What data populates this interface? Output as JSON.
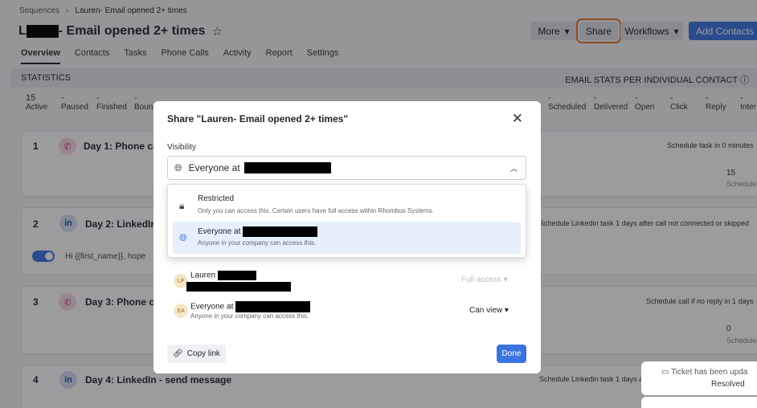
{
  "breadcrumb": {
    "root": "Sequences",
    "separator": "›",
    "current": "Lauren- Email opened 2+ times"
  },
  "title": {
    "prefix": "L",
    "suffix": "- Email opened 2+ times"
  },
  "header_buttons": {
    "more": "More",
    "share": "Share",
    "workflows": "Workflows",
    "add_contacts": "Add Contacts"
  },
  "tabs": [
    "Overview",
    "Contacts",
    "Tasks",
    "Phone Calls",
    "Activity",
    "Report",
    "Settings"
  ],
  "stats": {
    "left_label": "STATISTICS",
    "right_label": "EMAIL STATS PER INDIVIDUAL CONTACT",
    "left_items": [
      {
        "value": "15",
        "label": "Active"
      },
      {
        "value": "-",
        "label": "Paused"
      },
      {
        "value": "-",
        "label": "Finished"
      },
      {
        "value": "-",
        "label": "Bound"
      }
    ],
    "right_items": [
      {
        "value": "-",
        "label": "Scheduled"
      },
      {
        "value": "-",
        "label": "Delivered"
      },
      {
        "value": "-",
        "label": "Open"
      },
      {
        "value": "-",
        "label": "Click"
      },
      {
        "value": "-",
        "label": "Reply"
      },
      {
        "value": "-",
        "label": "Inter"
      }
    ]
  },
  "steps": [
    {
      "num": "1",
      "label": "Day 1: Phone ca",
      "right": "Schedule task in 0 minutes",
      "count": "15",
      "count_label": "Schedule"
    },
    {
      "num": "2",
      "label": "Day 2: LinkedIn",
      "right": "Schedule Linkedin task 1 days after call not connected or skipped",
      "message": "Hi {{first_name}}, hope"
    },
    {
      "num": "3",
      "label": "Day 3: Phone ca",
      "right": "Schedule call if no reply in 1 days",
      "count": "0",
      "count_label": "Schedule"
    },
    {
      "num": "4",
      "label": "Day 4: LinkedIn - send message",
      "right": "Schedule Linkedin task 1 days a"
    }
  ],
  "modal": {
    "title": "Share \"Lauren- Email opened 2+ times\"",
    "visibility_label": "Visibility",
    "selected_value": "Everyone at",
    "options": [
      {
        "title": "Restricted",
        "desc": "Only you can access this. Certain users have full access within Rhombus Systems."
      },
      {
        "title": "Everyone at",
        "desc": "Anyone in your company can access this."
      }
    ],
    "people": [
      {
        "initials": "LP",
        "name": "Lauren",
        "access": "Full access"
      },
      {
        "initials": "EA",
        "name": "Everyone at",
        "desc": "Anyone in your company can access this.",
        "access": "Can view"
      }
    ],
    "copy_link": "Copy link",
    "done": "Done"
  },
  "toast": {
    "text": "Ticket has been upda",
    "status": "Resolved"
  }
}
